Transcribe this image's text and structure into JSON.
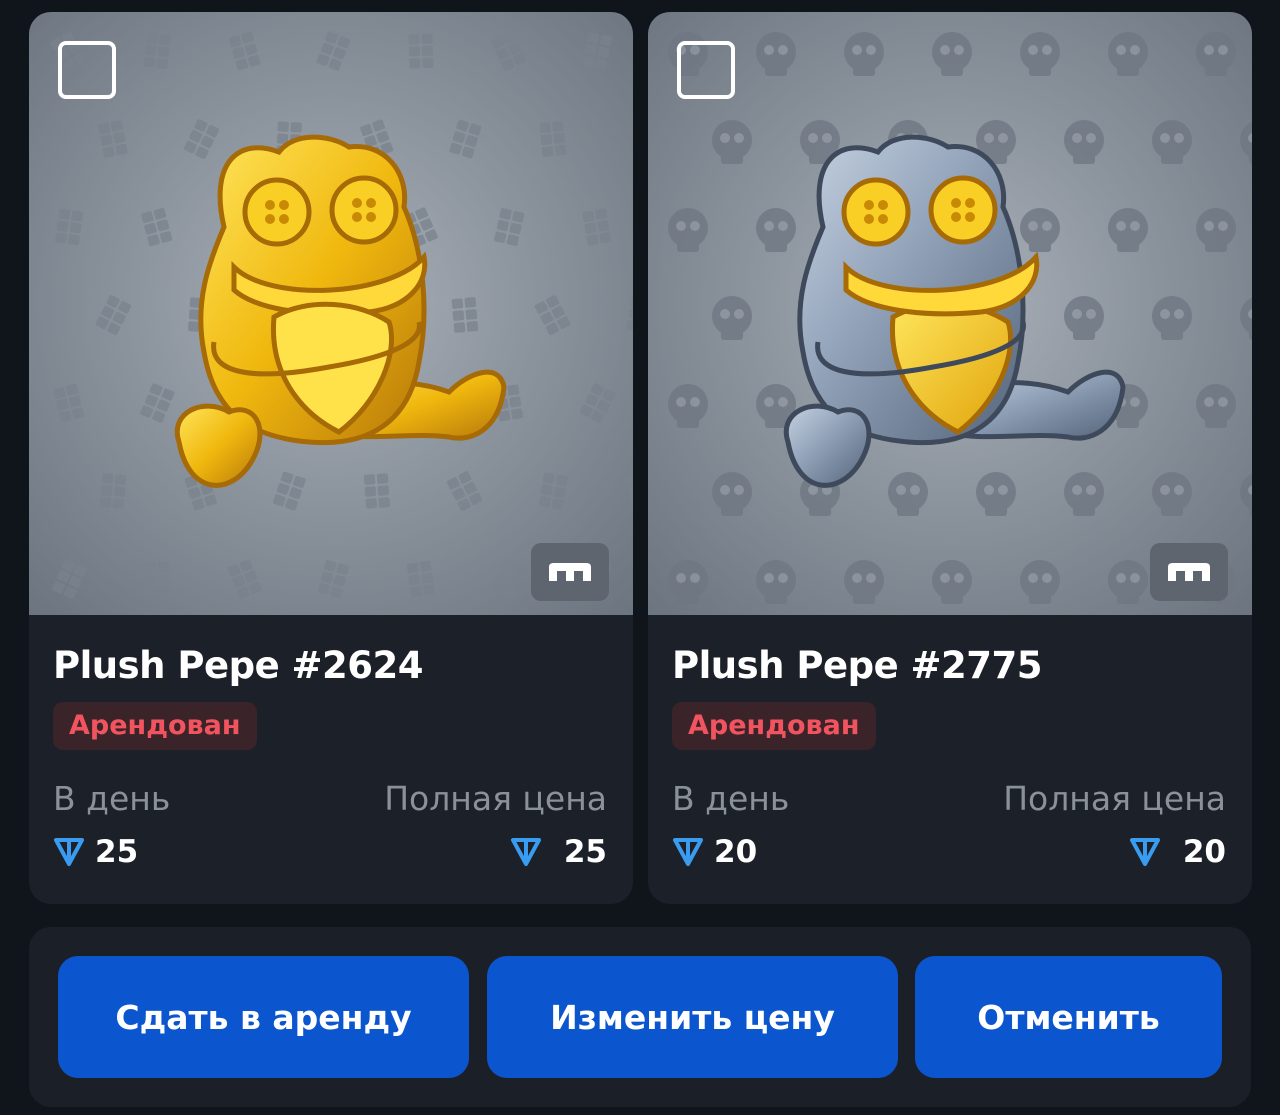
{
  "cards": [
    {
      "title": "Plush Pepe #2624",
      "status": "Арендован",
      "per_day_label": "В день",
      "full_price_label": "Полная цена",
      "per_day_price": "25",
      "full_price": "25",
      "variant": "gold",
      "background_pattern": "chocolate-bar-icon",
      "currency_icon": "ton-icon",
      "selected": false
    },
    {
      "title": "Plush Pepe #2775",
      "status": "Арендован",
      "per_day_label": "В день",
      "full_price_label": "Полная цена",
      "per_day_price": "20",
      "full_price": "20",
      "variant": "silver",
      "background_pattern": "skull-icon",
      "currency_icon": "ton-icon",
      "selected": false
    }
  ],
  "actions": {
    "rent_label": "Сдать в аренду",
    "change_price_label": "Изменить цену",
    "cancel_label": "Отменить"
  },
  "colors": {
    "background": "#10141b",
    "card": "#1c2129",
    "accent_button": "#0b56cf",
    "status_text": "#f2545f",
    "status_bg": "#3a2329",
    "ton_blue": "#3a9cf0"
  }
}
